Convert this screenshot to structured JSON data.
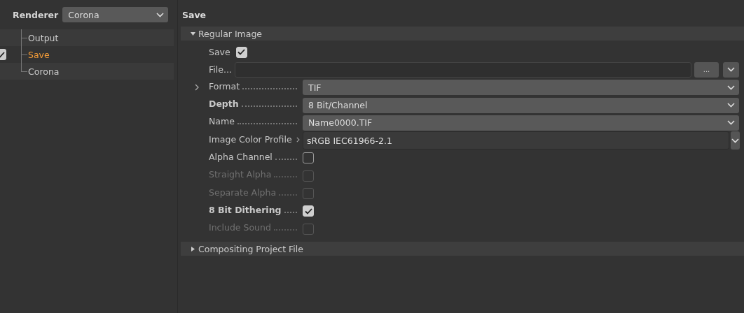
{
  "renderer": {
    "label": "Renderer",
    "value": "Corona"
  },
  "tree": [
    {
      "label": "Output",
      "selected": false
    },
    {
      "label": "Save",
      "selected": true,
      "checked": true
    },
    {
      "label": "Corona",
      "selected": false
    }
  ],
  "panel_title": "Save",
  "sections": [
    {
      "title": "Regular Image",
      "expanded": true,
      "rows": [
        {
          "kind": "inline-check",
          "label": "Save",
          "checked": true,
          "bold": false,
          "disabled": false
        },
        {
          "kind": "file",
          "label": "File...",
          "browse": "..."
        },
        {
          "kind": "dropdown",
          "label": "Format",
          "value": "TIF",
          "bold": false,
          "expander": true
        },
        {
          "kind": "dropdown",
          "label": "Depth",
          "value": "8 Bit/Channel",
          "bold": true,
          "expander": false
        },
        {
          "kind": "dropdown",
          "label": "Name",
          "value": "Name0000.TIF",
          "bold": false,
          "expander": false
        },
        {
          "kind": "profile",
          "label": "Image Color Profile",
          "value": "sRGB IEC61966-2.1"
        },
        {
          "kind": "check",
          "label": "Alpha Channel",
          "checked": false,
          "bold": false,
          "disabled": false
        },
        {
          "kind": "check",
          "label": "Straight Alpha",
          "checked": false,
          "bold": false,
          "disabled": true
        },
        {
          "kind": "check",
          "label": "Separate Alpha",
          "checked": false,
          "bold": false,
          "disabled": true
        },
        {
          "kind": "check",
          "label": "8 Bit Dithering",
          "checked": true,
          "bold": true,
          "disabled": false
        },
        {
          "kind": "check",
          "label": "Include Sound",
          "checked": false,
          "bold": false,
          "disabled": true
        }
      ]
    },
    {
      "title": "Compositing Project File",
      "expanded": false
    }
  ]
}
